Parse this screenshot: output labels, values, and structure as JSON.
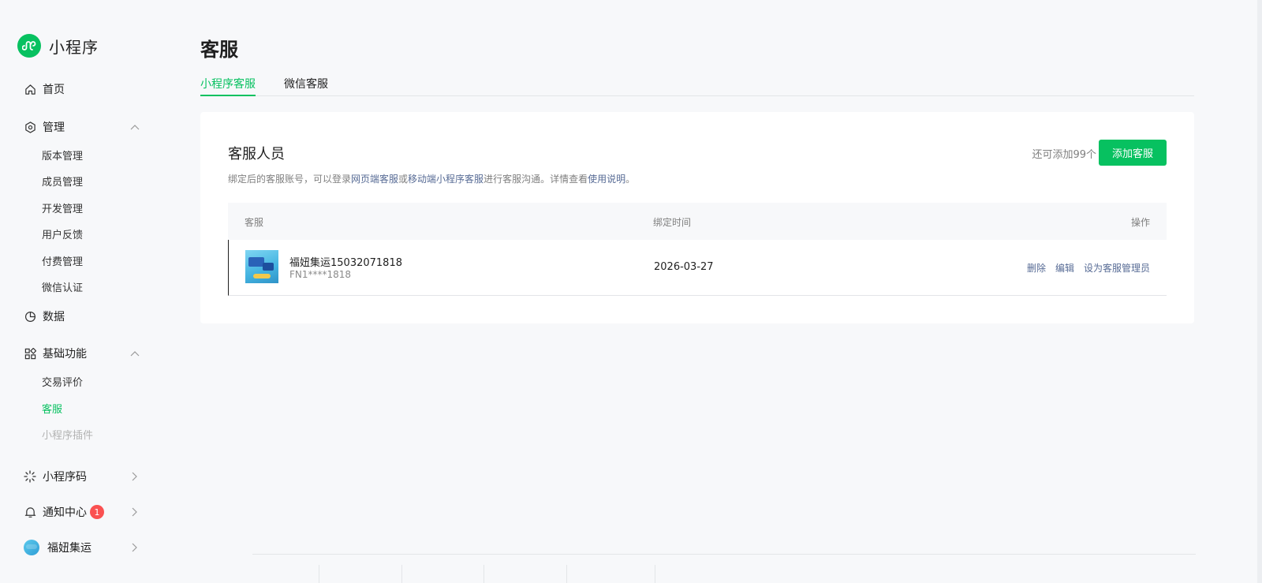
{
  "brand": {
    "title": "小程序"
  },
  "sidebar": {
    "home": "首页",
    "manage": {
      "label": "管理",
      "items": [
        "版本管理",
        "成员管理",
        "开发管理",
        "用户反馈",
        "付费管理",
        "微信认证"
      ]
    },
    "data": "数据",
    "basic": {
      "label": "基础功能",
      "items": [
        "交易评价",
        "客服",
        "小程序插件"
      ]
    },
    "qrcode": "小程序码",
    "notice": {
      "label": "通知中心",
      "count": "1"
    },
    "account": "福妞集运"
  },
  "page": {
    "title": "客服"
  },
  "tabs": [
    "小程序客服",
    "微信客服"
  ],
  "card": {
    "title": "客服人员",
    "quota": "还可添加99个",
    "add_label": "添加客服",
    "desc_prefix": "绑定后的客服账号，可以登录",
    "desc_link1": "网页端客服",
    "desc_or": "或",
    "desc_link2": "移动端小程序客服",
    "desc_mid": "进行客服沟通。详情查看",
    "desc_link3": "使用说明",
    "desc_end": "。"
  },
  "table": {
    "headers": [
      "客服",
      "绑定时间",
      "操作"
    ],
    "rows": [
      {
        "name": "福妞集运15032071818",
        "id": "FN1****1818",
        "time": "2026-03-27",
        "ops": [
          "删除",
          "编辑",
          "设为客服管理员"
        ]
      }
    ]
  },
  "colors": {
    "accent": "#07c160",
    "link": "#576b95",
    "badge": "#fa5151"
  }
}
